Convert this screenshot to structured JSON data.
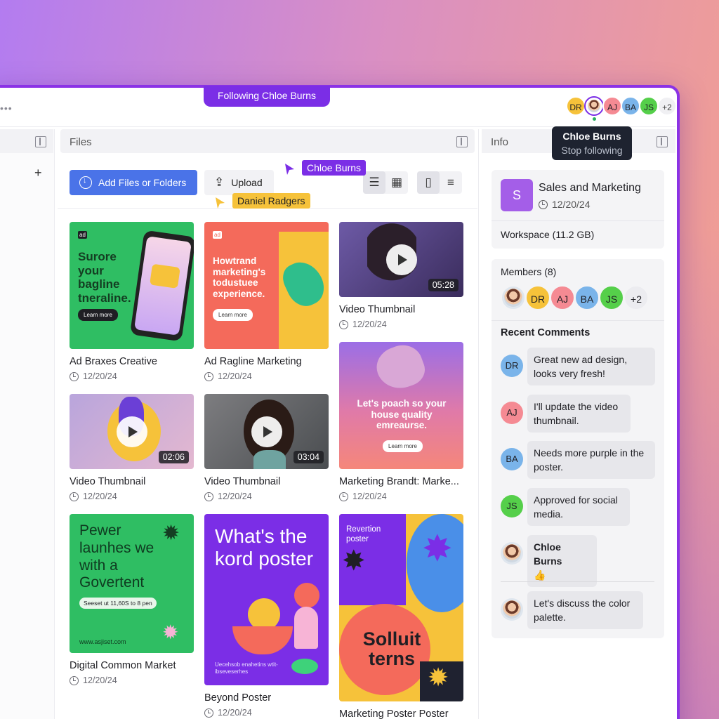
{
  "banner": {
    "following_label": "Following Chloe Burns"
  },
  "collaborators": {
    "avatars": [
      {
        "initials": "DR",
        "color": "#f6c23a"
      },
      {
        "initials": "",
        "name": "Chloe Burns",
        "color": "#ffffff"
      },
      {
        "initials": "AJ",
        "color": "#f58a93"
      },
      {
        "initials": "BA",
        "color": "#7ab4ea"
      },
      {
        "initials": "JS",
        "color": "#55cf4a"
      },
      {
        "initials": "+2"
      }
    ],
    "tooltip": {
      "name": "Chloe Burns",
      "action": "Stop following"
    }
  },
  "files_panel": {
    "title": "Files",
    "add_button": "Add Files or Folders",
    "upload_button": "Upload",
    "view_icons": [
      "list-icon",
      "grid-icon",
      "file-icon",
      "text-lines-icon"
    ]
  },
  "cursors": [
    {
      "name": "Chloe Burns",
      "color": "#7b2ee6"
    },
    {
      "name": "Daniel Radgers",
      "color": "#f6c23a"
    }
  ],
  "files": [
    {
      "title": "Ad Braxes Creative",
      "date": "12/20/24",
      "type": "image",
      "poster_text": "Surore your bagline tneraline.",
      "cta": "Learn more",
      "badge": "ad"
    },
    {
      "title": "Ad Ragline Marketing",
      "date": "12/20/24",
      "type": "image",
      "poster_text": "Howtrand marketing's todustuee experience.",
      "cta": "Learn more",
      "badge": "ad"
    },
    {
      "title": "Video Thumbnail",
      "date": "12/20/24",
      "type": "video",
      "duration": "05:28"
    },
    {
      "title": "Video Thumbnail",
      "date": "12/20/24",
      "type": "video",
      "duration": "02:06"
    },
    {
      "title": "Video Thumbnail",
      "date": "12/20/24",
      "type": "video",
      "duration": "03:04"
    },
    {
      "title": "Marketing Brandt: Marke...",
      "date": "12/20/24",
      "type": "image",
      "poster_text": "Let's poach so your house quality emreaurse.",
      "cta": "Learn more"
    },
    {
      "title": "Digital Common Market",
      "date": "12/20/24",
      "type": "image",
      "poster_text": "Pewer launhes we with a Govertent",
      "sub": "Seeset ut 11,60S to 8 pen",
      "footer": "www.asjiset.com"
    },
    {
      "title": "Beyond Poster",
      "date": "12/20/24",
      "type": "image",
      "poster_text": "What's the kord poster",
      "footer": "Uecehsob enahetins wtit-ibseveserhes"
    },
    {
      "title": "Marketing Poster Poster",
      "date": "",
      "type": "image",
      "poster_text": "Solluit terns",
      "label": "Revertion poster"
    }
  ],
  "info_panel": {
    "title": "Info",
    "workspace": {
      "initial": "S",
      "name": "Sales and Marketing",
      "date": "12/20/24",
      "size": "Workspace (11.2 GB)"
    },
    "members": {
      "title": "Members (8)",
      "avatars": [
        {
          "initials": "",
          "photo": true
        },
        {
          "initials": "DR",
          "color": "#f6c23a"
        },
        {
          "initials": "AJ",
          "color": "#f58a93"
        },
        {
          "initials": "BA",
          "color": "#7ab4ea"
        },
        {
          "initials": "JS",
          "color": "#55cf4a"
        },
        {
          "initials": "+2",
          "color": "#ececf0"
        }
      ]
    },
    "recent_comments_title": "Recent Comments",
    "comments": [
      {
        "initials": "DR",
        "color": "#7ab4ea",
        "text": "Great new ad design, looks very fresh!"
      },
      {
        "initials": "AJ",
        "color": "#f58a93",
        "text": "I'll update the video thumbnail."
      },
      {
        "initials": "BA",
        "color": "#7ab4ea",
        "text": "Needs more purple in the poster."
      },
      {
        "initials": "JS",
        "color": "#55cf4a",
        "text": "Approved for social media."
      },
      {
        "initials": "",
        "photo": true,
        "author": "Chloe Burns",
        "text": "👍"
      },
      {
        "initials": "",
        "photo": true,
        "text": "Let's discuss the color palette."
      }
    ]
  }
}
